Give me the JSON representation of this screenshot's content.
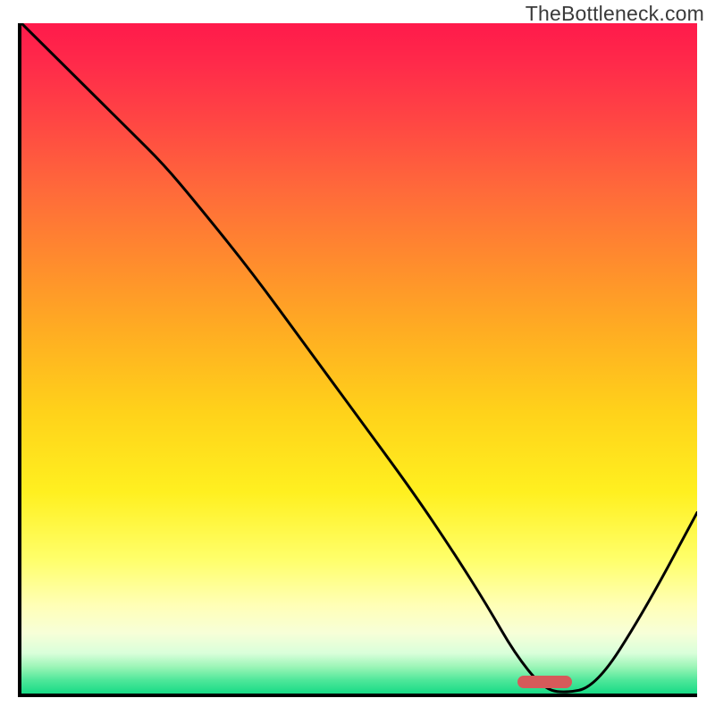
{
  "watermark": "TheBottleneck.com",
  "colors": {
    "axis": "#000000",
    "curve": "#000000",
    "marker": "#d65a5a"
  },
  "chart_data": {
    "type": "line",
    "title": "",
    "xlabel": "",
    "ylabel": "",
    "xlim": [
      0,
      100
    ],
    "ylim": [
      0,
      100
    ],
    "grid": false,
    "legend": false,
    "note": "Axes have no tick labels in the image; x/y are normalized 0–100. y is the curve height (0 = bottom/green, 100 = top/red).",
    "series": [
      {
        "name": "bottleneck-curve",
        "x": [
          0,
          8,
          16,
          21,
          26,
          34,
          42,
          50,
          58,
          64,
          69,
          73,
          77,
          80,
          85,
          92,
          100
        ],
        "y": [
          100,
          92,
          84,
          79,
          73,
          63,
          52,
          41,
          30,
          21,
          13,
          6,
          1,
          0,
          1,
          12,
          27
        ]
      }
    ],
    "optimum_marker": {
      "x_start": 73,
      "x_end": 81,
      "y": 0.6,
      "description": "rounded red bar marking the curve minimum"
    },
    "gradient_stops": [
      {
        "pct": 0,
        "color": "#ff1a4b"
      },
      {
        "pct": 25,
        "color": "#ff6a3a"
      },
      {
        "pct": 58,
        "color": "#ffd21a"
      },
      {
        "pct": 80,
        "color": "#ffff6a"
      },
      {
        "pct": 100,
        "color": "#18db86"
      }
    ]
  }
}
